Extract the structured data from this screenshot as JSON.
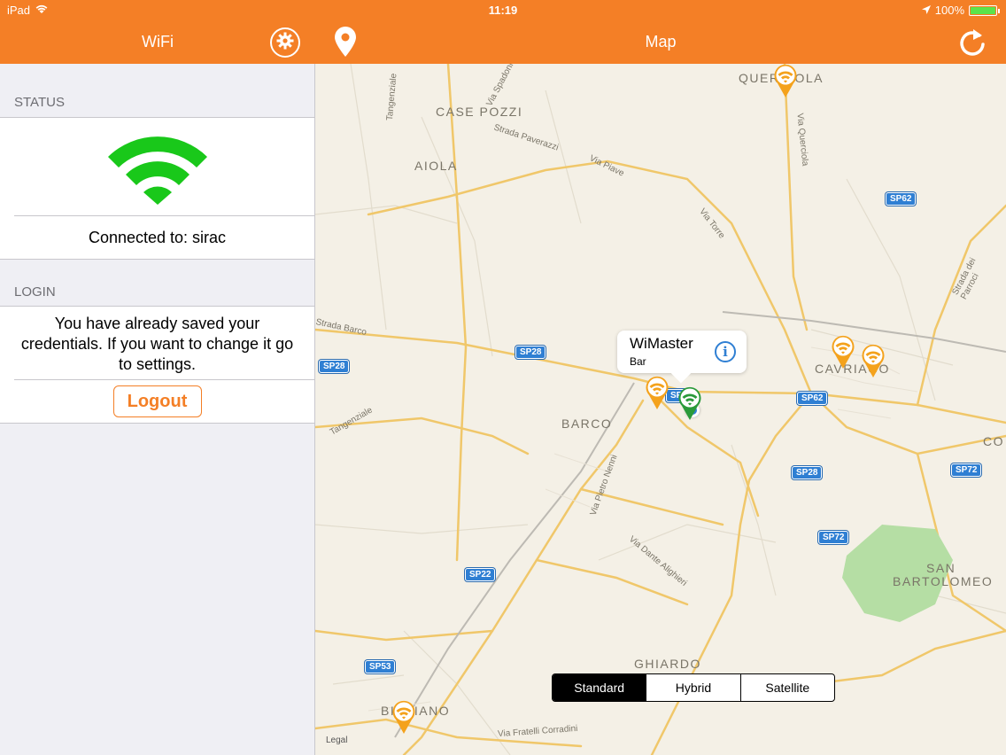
{
  "status_bar": {
    "device": "iPad",
    "time": "11:19",
    "battery": "100%",
    "battery_level": 1.0
  },
  "left_panel": {
    "title": "WiFi",
    "status_header": "STATUS",
    "connected_text": "Connected to: sirac",
    "login_header": "LOGIN",
    "login_message": "You have already saved your credentials. If you want to change it go to settings.",
    "logout_label": "Logout",
    "wifi_color": "#19c81a"
  },
  "map_panel": {
    "title": "Map",
    "places": [
      "Querciola",
      "Case Pozzi",
      "Aiola",
      "Barco",
      "Cavriago",
      "Ghiardo",
      "San",
      "Bartolomeo",
      "Bibbiano",
      "Co"
    ],
    "roads": [
      "Via Spadoni",
      "Strada Paverazzi",
      "Via Piave",
      "Via Torre",
      "Via Querciola",
      "Strada dei Parroci",
      "Strada Barco",
      "Tangenziale",
      "Via Pietro Nenni",
      "Via Dante Alighieri",
      "Via Fratelli Corradini",
      "Tangenziale"
    ],
    "shields": [
      "SP62",
      "SP28",
      "SP28",
      "SP62",
      "SP28",
      "SP72",
      "SP72",
      "SP22",
      "SP53",
      "SP"
    ],
    "callout": {
      "title": "WiMaster",
      "subtitle": "Bar",
      "info_glyph": "i"
    },
    "map_types": [
      "Standard",
      "Hybrid",
      "Satellite"
    ],
    "selected_map_type": "Standard",
    "legal": "Legal",
    "marker_color_orange": "#f4a21c",
    "marker_color_green": "#2a9a3a",
    "accent": "#f47f26"
  }
}
